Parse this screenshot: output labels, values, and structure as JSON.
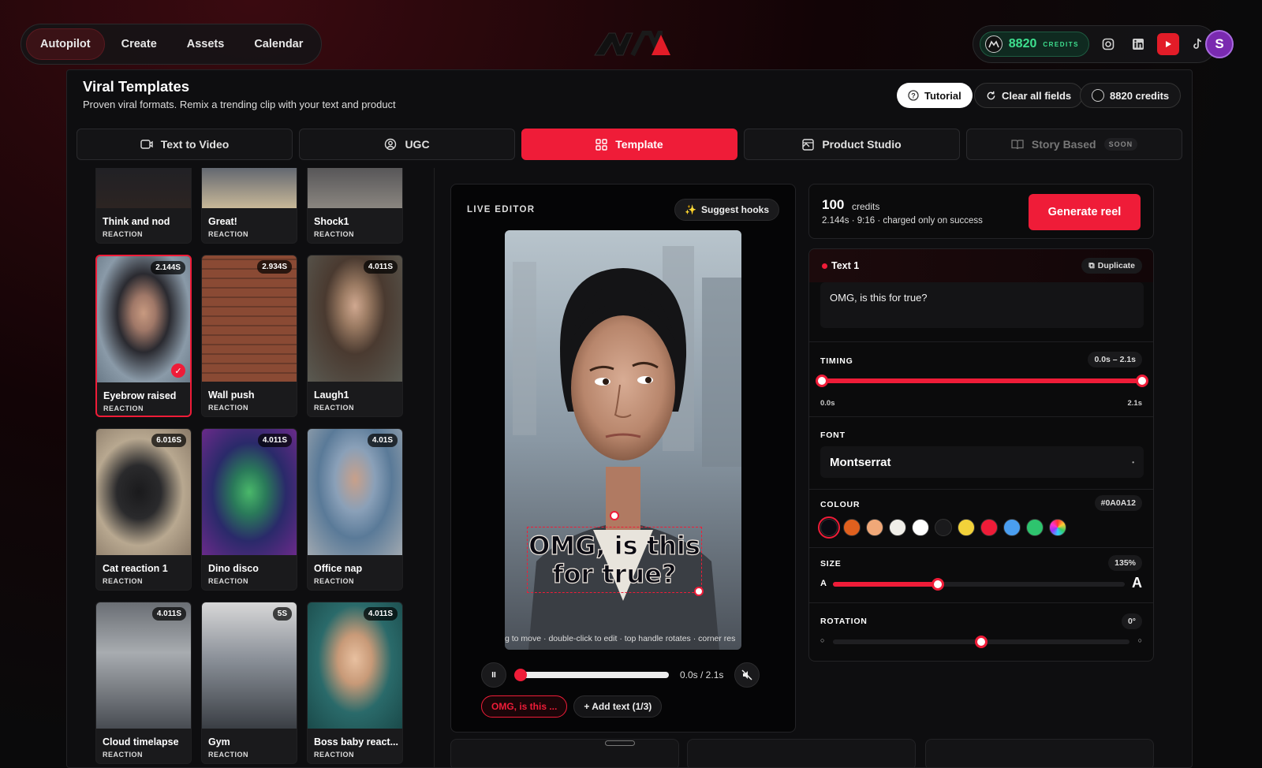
{
  "topnav": {
    "items": [
      {
        "label": "Autopilot",
        "active": true
      },
      {
        "label": "Create",
        "active": false
      },
      {
        "label": "Assets",
        "active": false
      },
      {
        "label": "Calendar",
        "active": false
      }
    ]
  },
  "account": {
    "credits": "8820",
    "credits_label": "CREDITS",
    "avatar_initial": "S",
    "socials": [
      "instagram-icon",
      "linkedin-icon",
      "youtube-icon",
      "tiktok-icon"
    ]
  },
  "header": {
    "title": "Viral Templates",
    "subtitle": "Proven viral formats. Remix a trending clip with your text and product",
    "tutorial": "Tutorial",
    "clear": "Clear all fields",
    "credits": "8820 credits"
  },
  "tabs": [
    {
      "label": "Text to Video",
      "icon": "video-icon"
    },
    {
      "label": "UGC",
      "icon": "user-circle-icon"
    },
    {
      "label": "Template",
      "icon": "grid-icon",
      "active": true
    },
    {
      "label": "Product Studio",
      "icon": "image-icon"
    },
    {
      "label": "Story Based",
      "icon": "book-icon",
      "badge": "SOON"
    }
  ],
  "templates": [
    {
      "name": "Think and nod",
      "cat": "REACTION",
      "dur": ""
    },
    {
      "name": "Great!",
      "cat": "REACTION",
      "dur": ""
    },
    {
      "name": "Shock1",
      "cat": "REACTION",
      "dur": ""
    },
    {
      "name": "Eyebrow raised",
      "cat": "REACTION",
      "dur": "2.144S",
      "selected": true
    },
    {
      "name": "Wall push",
      "cat": "REACTION",
      "dur": "2.934S"
    },
    {
      "name": "Laugh1",
      "cat": "REACTION",
      "dur": "4.011S"
    },
    {
      "name": "Cat reaction 1",
      "cat": "REACTION",
      "dur": "6.016S"
    },
    {
      "name": "Dino disco",
      "cat": "REACTION",
      "dur": "4.011S"
    },
    {
      "name": "Office nap",
      "cat": "REACTION",
      "dur": "4.01S"
    },
    {
      "name": "Cloud timelapse",
      "cat": "REACTION",
      "dur": "4.011S"
    },
    {
      "name": "Gym",
      "cat": "REACTION",
      "dur": "5S"
    },
    {
      "name": "Boss baby react...",
      "cat": "REACTION",
      "dur": "4.011S"
    }
  ],
  "editor": {
    "label": "LIVE EDITOR",
    "suggest": "Suggest hooks",
    "overlay_line1": "OMG, is this",
    "overlay_line2": "for true?",
    "hint": "g to move · double-click to edit · top handle rotates · corner res",
    "pause": "II",
    "time": "0.0s / 2.1s",
    "progress": 0,
    "chip_text": "OMG, is this ...",
    "add_text": "+ Add text (1/3)"
  },
  "generate": {
    "credits": "100",
    "unit": "credits",
    "meta": "2.144s · 9:16 · charged only on success",
    "button": "Generate reel"
  },
  "text_props": {
    "title": "Text 1",
    "duplicate": "Duplicate",
    "value": "OMG, is this for true?",
    "timing_label": "TIMING",
    "timing_range": "0.0s – 2.1s",
    "timing_start": "0.0s",
    "timing_end": "2.1s",
    "font_label": "FONT",
    "font": "Montserrat",
    "colour_label": "COLOUR",
    "colour_hex": "#0A0A12",
    "swatches": [
      "#0A0A12",
      "#E0601E",
      "#F0A878",
      "#F0EEE8",
      "#FFFFFF",
      "#1A1A1C",
      "#F2D23A",
      "#EE1C38",
      "#4A9EF0",
      "#2EC46E",
      "rainbow"
    ],
    "size_label": "SIZE",
    "size_value": "135%",
    "size_fraction": 0.36,
    "size_small": "A",
    "size_big": "A",
    "rotation_label": "ROTATION",
    "rotation_value": "0°",
    "rotation_fraction": 0.5
  },
  "colors": {
    "accent": "#EF1C38",
    "credits_green": "#3EE08F"
  }
}
